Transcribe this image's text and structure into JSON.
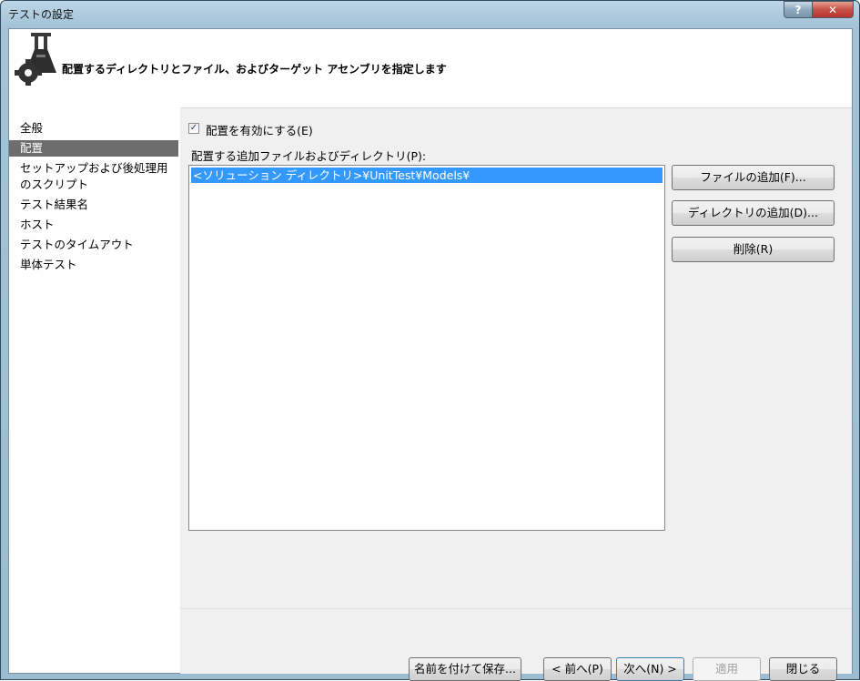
{
  "window": {
    "title": "テストの設定",
    "help_label": "?",
    "close_label": "✕"
  },
  "header": {
    "text": "配置するディレクトリとファイル、およびターゲット アセンブリを指定します",
    "icon": "flask-gear-icon"
  },
  "sidebar": {
    "items": [
      {
        "label": "全般"
      },
      {
        "label": "配置",
        "selected": true
      },
      {
        "label": "セットアップおよび後処理用"
      },
      {
        "label": "のスクリプト"
      },
      {
        "label": "テスト結果名"
      },
      {
        "label": "ホスト"
      },
      {
        "label": "テストのタイムアウト"
      },
      {
        "label": "単体テスト"
      }
    ]
  },
  "deployment": {
    "enable_checked": true,
    "enable_label": "配置を有効にする(E)",
    "list_label": "配置する追加ファイルおよびディレクトリ(P):",
    "items": [
      "<ソリューション ディレクトリ>¥UnitTest¥Models¥"
    ],
    "add_file_label": "ファイルの追加(F)...",
    "add_dir_label": "ディレクトリの追加(D)...",
    "remove_label": "削除(R)"
  },
  "footer": {
    "save_as_label": "名前を付けて保存...",
    "prev_label": "< 前へ(P)",
    "next_label": "次へ(N) >",
    "apply_label": "適用",
    "close_label": "閉じる"
  }
}
